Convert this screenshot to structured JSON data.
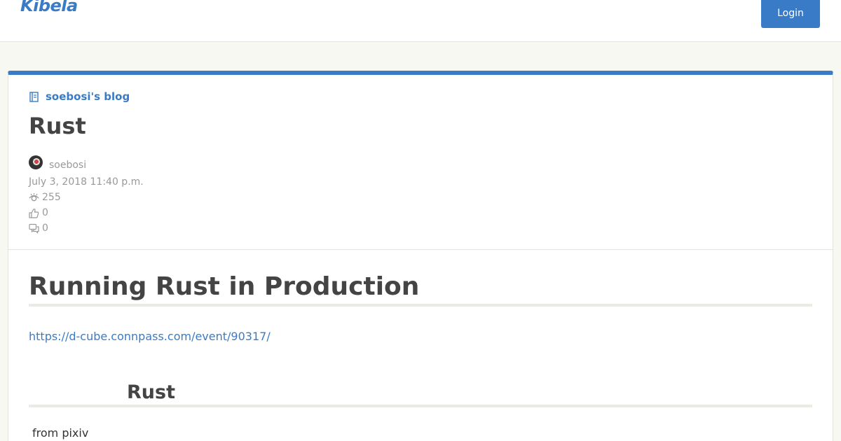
{
  "header": {
    "logo_text": "Kibela",
    "login_label": "Login"
  },
  "post": {
    "blog_name": "soebosi's blog",
    "title": "Rust",
    "author": "soebosi",
    "date": "July 3, 2018 11:40 p.m.",
    "views": "255",
    "likes": "0",
    "comments": "0"
  },
  "content": {
    "heading1": "Running Rust in Production",
    "link": "https://d-cube.connpass.com/event/90317/",
    "heading2": "Rust",
    "paragraph": "from pixiv"
  },
  "colors": {
    "accent": "#3a7bc8",
    "background": "#f8f8f3",
    "text": "#444444"
  },
  "icons": [
    "notebook-icon",
    "eye-icon",
    "thumbs-up-icon",
    "comment-icon"
  ]
}
